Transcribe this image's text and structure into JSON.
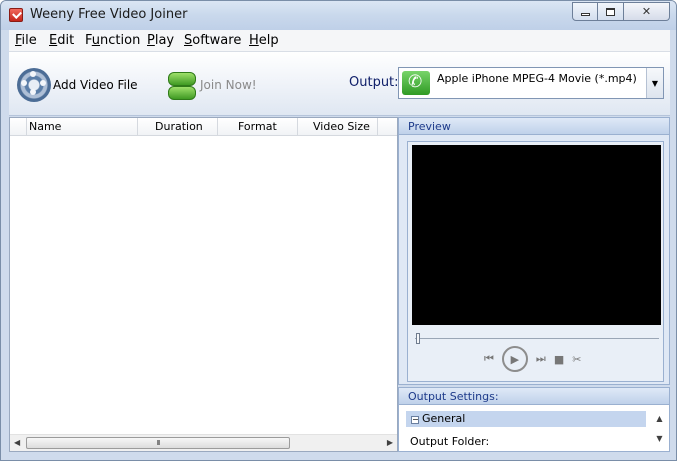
{
  "window": {
    "title": "Weeny Free Video Joiner"
  },
  "menu": [
    {
      "pre": "",
      "ul": "F",
      "post": "ile"
    },
    {
      "pre": "",
      "ul": "E",
      "post": "dit"
    },
    {
      "pre": "F",
      "ul": "u",
      "post": "nction"
    },
    {
      "pre": "",
      "ul": "P",
      "post": "lay"
    },
    {
      "pre": "",
      "ul": "S",
      "post": "oftware"
    },
    {
      "pre": "",
      "ul": "H",
      "post": "elp"
    }
  ],
  "toolbar": {
    "add_label": "Add Video File",
    "join_label": "Join Now!",
    "output_label": "Output:",
    "output_value": "Apple iPhone MPEG-4 Movie (*.mp4)"
  },
  "list": {
    "columns": [
      "Name",
      "Duration",
      "Format",
      "Video Size"
    ],
    "thumb_grip": "III"
  },
  "preview": {
    "title": "Preview"
  },
  "output_settings": {
    "title": "Output Settings:",
    "group_label": "General",
    "folder_label": "Output Folder:"
  }
}
